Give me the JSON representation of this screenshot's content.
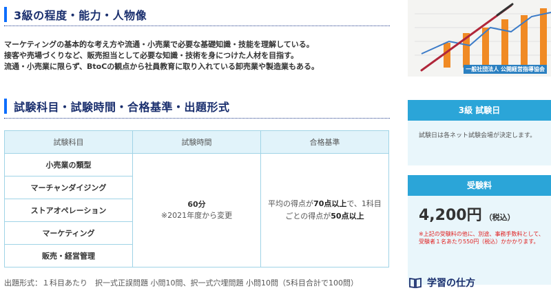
{
  "grade_section": {
    "heading": "3級の程度・能力・人物像",
    "lines": [
      "マーケティングの基本的な考え方や流通・小売業で必要な基礎知識・技能を理解している。",
      "接客や売場づくりなど、販売担当として必要な知識・技術を身につけた人材を目指す。",
      "流通・小売業に限らず、BtoCの観点から社員教育に取り入れている卸売業や製造業もある。"
    ]
  },
  "exam_section": {
    "heading": "試験科目・試験時間・合格基準・出題形式",
    "columns": [
      "試験科目",
      "試験時間",
      "合格基準"
    ],
    "subjects": [
      "小売業の類型",
      "マーチャンダイジング",
      "ストアオペレーション",
      "マーケティング",
      "販売・経営管理"
    ],
    "time_main": "60分",
    "time_note": "※2021年度から変更",
    "pass_pre": "平均の得点が",
    "pass_b1": "70点以上",
    "pass_mid": "で、1科目ごとの得点が",
    "pass_b2": "50点以上",
    "footnote": "出題形式：１科目あたり　択一式正誤問題 小問10問、択一式穴埋問題 小問10問（5科目合計で100問）"
  },
  "sidebar": {
    "banner_caption": "一般社団法人 公開経営指導協会",
    "exam_date_title": "3級 試験日",
    "exam_date_text": "試験日は各ネット試験会場が決定します。",
    "fee_title": "受験料",
    "fee_amount": "4,200円",
    "fee_tax": "（税込）",
    "fee_note": "※上記の受験料の他に、別途、事務手数料として、受験者１名あたり550円（税込）かかかります。",
    "howto_label": "学習の仕方"
  },
  "colors": {
    "heading_navy": "#1a2f6e",
    "accent_blue": "#0d6efd",
    "card_head": "#2ba5d8",
    "card_body": "#e9f6fb",
    "note_red": "#e02020"
  },
  "icons": {
    "howto": "open-book-icon"
  }
}
